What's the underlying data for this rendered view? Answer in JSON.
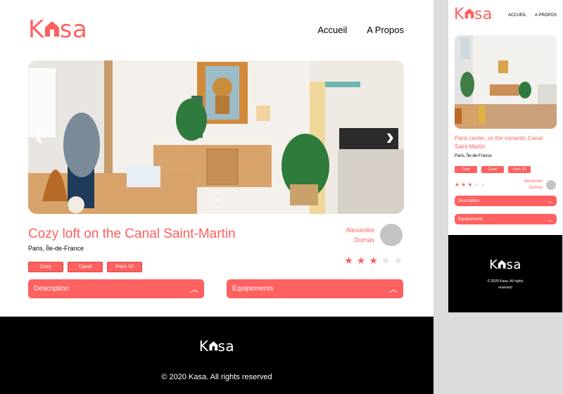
{
  "brand": {
    "logo_k": "K",
    "logo_sa": "sa",
    "accent": "#ff6060"
  },
  "desktop": {
    "nav": [
      "Accueil",
      "A Propos"
    ],
    "gallery": {
      "counter": "1/4",
      "prev_icon": "chevron-left-icon",
      "next_icon": "chevron-right-icon"
    },
    "title": "Cozy loft on the Canal Saint-Martin",
    "location": "Paris, Île-de-France",
    "tags": [
      "Cozy",
      "Canal",
      "Paris 10"
    ],
    "host": {
      "first": "Alexandre",
      "last": "Dumas"
    },
    "rating": 3,
    "rating_max": 5,
    "collapses": {
      "description": "Description",
      "equipments": "Équipements"
    },
    "footer": "© 2020 Kasa. All rights reserved"
  },
  "mobile": {
    "nav": [
      "ACCUEIL",
      "A PROPOS"
    ],
    "title": "Paris center, on the romantic Canal Saint-Martin",
    "location": "Paris, Île-de-France",
    "tags": [
      "Cozy",
      "Canal",
      "Paris 10"
    ],
    "host": {
      "first": "Alexandre",
      "last": "Dumas"
    },
    "rating": 3,
    "rating_max": 5,
    "collapses": {
      "description": "Description",
      "equipments": "Équipements"
    },
    "footer": "© 2020 Kasa. All rights reserved"
  }
}
